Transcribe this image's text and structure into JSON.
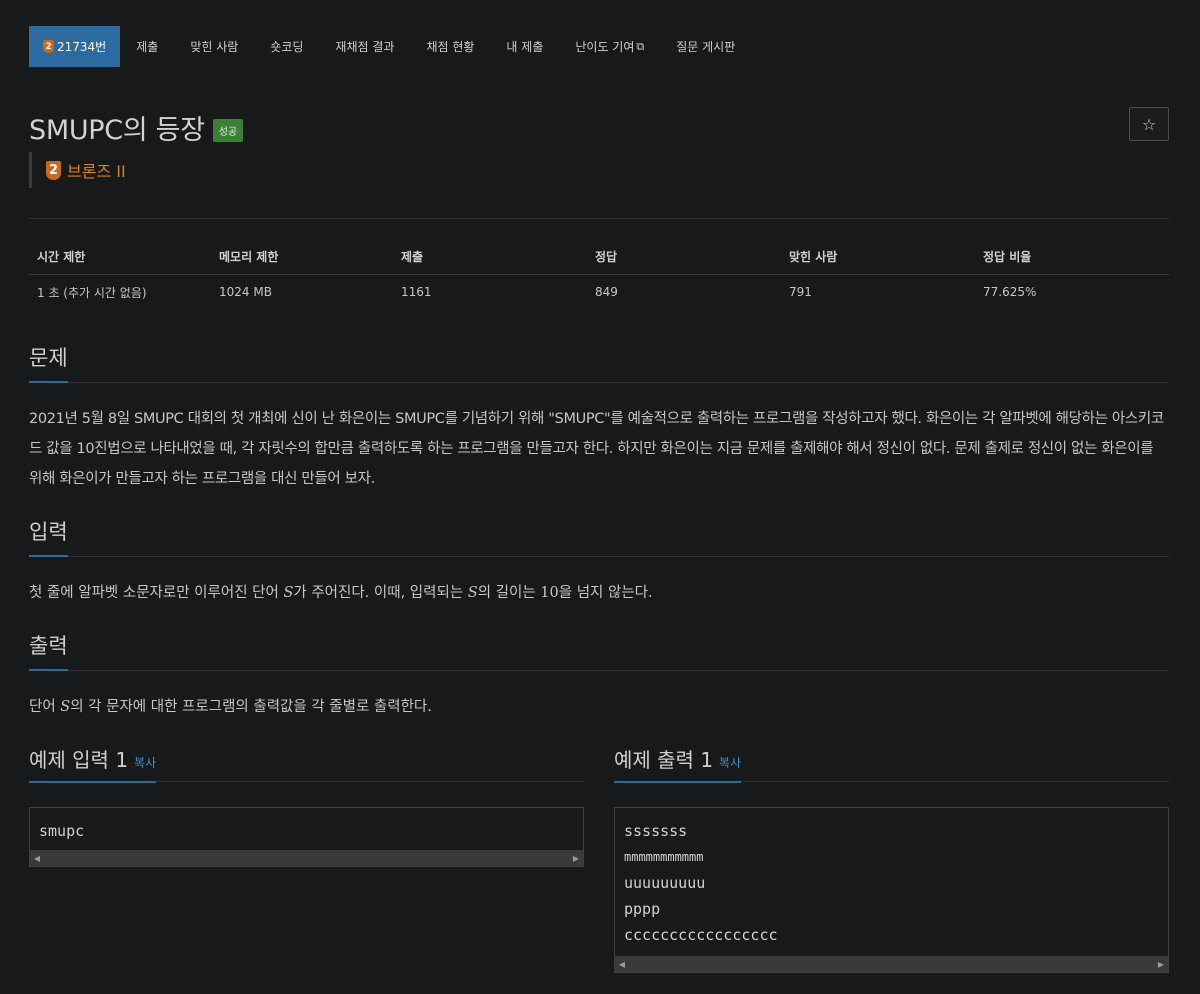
{
  "nav": {
    "problem_id": "21734번",
    "tier_badge": "2",
    "items": [
      "제출",
      "맞힌 사람",
      "숏코딩",
      "재채점 결과",
      "채점 현황",
      "내 제출",
      "난이도 기여",
      "질문 게시판"
    ]
  },
  "problem": {
    "title": "SMUPC의 등장",
    "status_label": "성공",
    "star": "☆",
    "tier_num": "2",
    "tier_name": "브론즈 II"
  },
  "info": {
    "headers": [
      "시간 제한",
      "메모리 제한",
      "제출",
      "정답",
      "맞힌 사람",
      "정답 비율"
    ],
    "values": [
      "1 초 (추가 시간 없음)",
      "1024 MB",
      "1161",
      "849",
      "791",
      "77.625%"
    ]
  },
  "sections": {
    "problem_title": "문제",
    "problem_text": "2021년 5월 8일 SMUPC 대회의 첫 개최에 신이 난 화은이는 SMUPC를 기념하기 위해 \"SMUPC\"를 예술적으로 출력하는 프로그램을 작성하고자 했다. 화은이는 각 알파벳에 해당하는 아스키코드 값을 10진법으로 나타내었을 때, 각 자릿수의 합만큼 출력하도록 하는 프로그램을 만들고자 한다. 하지만 화은이는 지금 문제를 출제해야 해서 정신이 없다. 문제 출제로 정신이 없는 화은이를 위해 화은이가 만들고자 하는 프로그램을 대신 만들어 보자.",
    "input_title": "입력",
    "input_text": {
      "part1": "첫 줄에 알파벳 소문자로만 이루어진 단어 ",
      "var1": "S",
      "part2": "가 주어진다. 이때, 입력되는 ",
      "var2": "S",
      "part3": "의 길이는 ",
      "num": "10",
      "part4": "을 넘지 않는다."
    },
    "output_title": "출력",
    "output_text": {
      "part1": "단어 ",
      "var1": "S",
      "part2": "의 각 문자에 대한 프로그램의 출력값을 각 줄별로 출력한다."
    }
  },
  "samples": {
    "input_title": "예제 입력 1",
    "output_title": "예제 출력 1",
    "copy_label": "복사",
    "input_lines": [
      "smupc"
    ],
    "output_lines": [
      "sssssss",
      "mmmmmmmmmmm",
      "uuuuuuuuu",
      "pppp",
      "ccccccccccccccccc"
    ]
  },
  "colors": {
    "background": "#18191b",
    "accent": "#2d6aa0",
    "success": "#3c8038",
    "tier_bronze": "#c86a1d",
    "link": "#3d8fd6"
  },
  "icons": {
    "nav_tier": "bronze-tier-badge-icon",
    "external": "external-link-icon",
    "star": "star-icon"
  }
}
